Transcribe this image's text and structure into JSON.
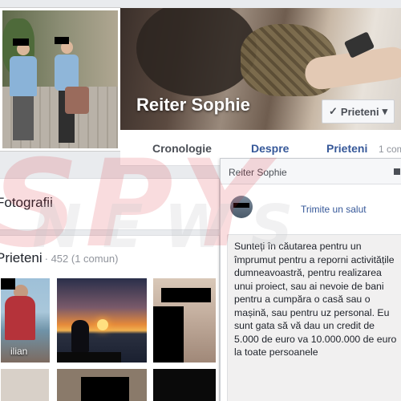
{
  "profile": {
    "name": "Reiter Sophie",
    "friend_button_label": "Prieteni",
    "friend_button_check": "✓",
    "friend_button_caret": "▾"
  },
  "tabs": [
    {
      "label": "Cronologie"
    },
    {
      "label": "Despre"
    },
    {
      "label": "Prieteni"
    }
  ],
  "tabs_count": "1 com",
  "photos_section": {
    "title": "Fotografii"
  },
  "friends_section": {
    "title": "Prieteni",
    "count": "· 452 (1 comun)",
    "first_friend_caption": "ilian"
  },
  "chat": {
    "title": "Reiter Sophie",
    "greeting_link": "Trimite un salut",
    "message": "Sunteți în căutarea pentru un împrumut pentru a reporni activitățile dumneavoastră, pentru realizarea unui proiect, sau ai nevoie de bani pentru a cumpăra o casă sau o mașină, sau pentru uz personal. Eu sunt gata să vă dau un credit de 5.000 de euro va 10.000.000 de euro la toate persoanele"
  },
  "watermark": {
    "line1": "SPY",
    "line2": "NEWS"
  },
  "colors": {
    "link": "#365899",
    "page_bg": "#e9ebee",
    "watermark_red": "#dc2832"
  }
}
